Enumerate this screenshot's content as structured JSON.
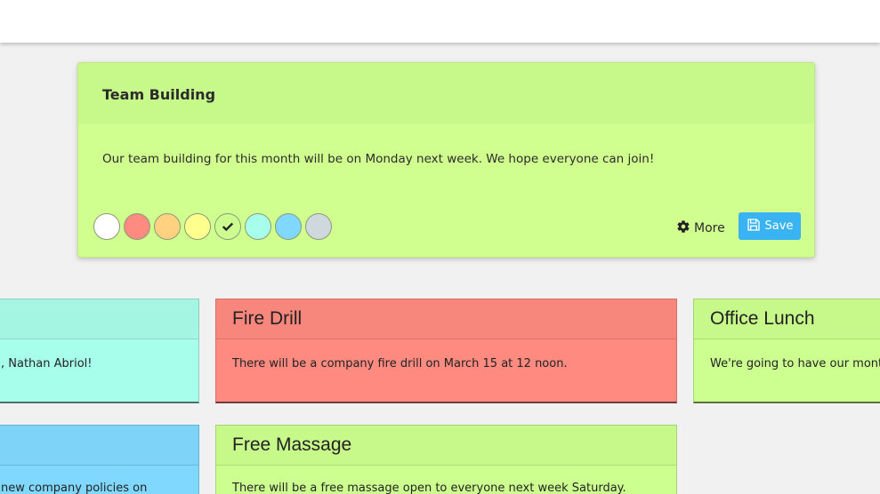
{
  "editor": {
    "title": "Team Building",
    "body": "Our team building for this month will be on Monday next week. We hope everyone can join!",
    "colors": [
      {
        "name": "white",
        "hex": "#ffffff",
        "selected": false
      },
      {
        "name": "red",
        "hex": "#ff8a80",
        "selected": false
      },
      {
        "name": "orange",
        "hex": "#ffd180",
        "selected": false
      },
      {
        "name": "yellow",
        "hex": "#ffff8d",
        "selected": false
      },
      {
        "name": "green",
        "hex": "#ccff90",
        "selected": true
      },
      {
        "name": "teal",
        "hex": "#a7ffeb",
        "selected": false
      },
      {
        "name": "blue",
        "hex": "#80d8ff",
        "selected": false
      },
      {
        "name": "gray",
        "hex": "#cfd8dc",
        "selected": false
      }
    ],
    "more_label": "More",
    "save_label": "Save"
  },
  "notes": [
    {
      "title": "",
      "body": ", Nathan Abriol!",
      "color": "#a7ffeb",
      "header_color": "#a5f5e3"
    },
    {
      "title": "Fire Drill",
      "body": "There will be a company fire drill on March 15 at 12 noon.",
      "color": "#ff8a80",
      "header_color": "#f7877c"
    },
    {
      "title": "Office Lunch",
      "body": "We're going to have our month",
      "color": "#ccff90",
      "header_color": "#c7f88a"
    },
    {
      "title": "",
      "body": "new company policies on",
      "color": "#80d8ff",
      "header_color": "#7dd3f8"
    },
    {
      "title": "Free Massage",
      "body": "There will be a free massage open to everyone next week Saturday.",
      "color": "#ccff90",
      "header_color": "#c7f88a"
    }
  ]
}
